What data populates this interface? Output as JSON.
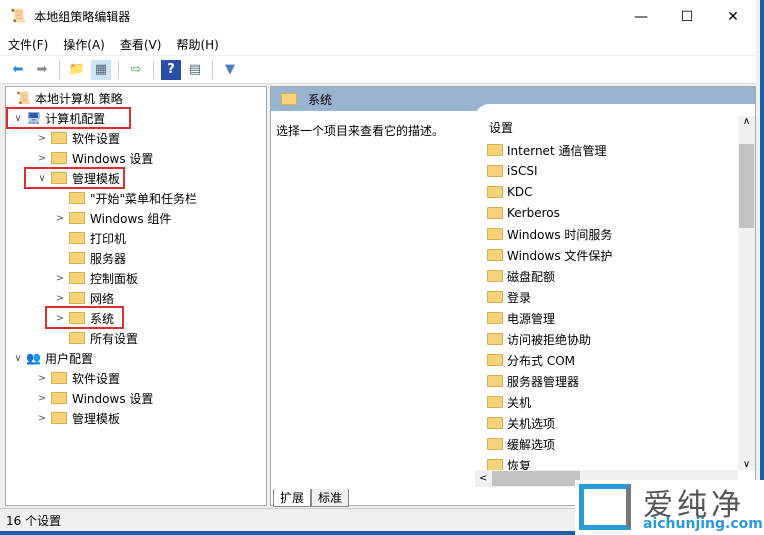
{
  "window": {
    "title": "本地组策略编辑器",
    "minimize": "—",
    "maximize": "☐",
    "close": "✕"
  },
  "menu": [
    "文件(F)",
    "操作(A)",
    "查看(V)",
    "帮助(H)"
  ],
  "tree": [
    {
      "label": "本地计算机 策略",
      "level": 0,
      "arrow": ""
    },
    {
      "label": "计算机配置",
      "level": 0,
      "arrow": "∨"
    },
    {
      "label": "软件设置",
      "level": 1,
      "arrow": ">"
    },
    {
      "label": "Windows 设置",
      "level": 1,
      "arrow": ">"
    },
    {
      "label": "管理模板",
      "level": 1,
      "arrow": "∨"
    },
    {
      "label": "\"开始\"菜单和任务栏",
      "level": 2,
      "arrow": ""
    },
    {
      "label": "Windows 组件",
      "level": 2,
      "arrow": ">"
    },
    {
      "label": "打印机",
      "level": 2,
      "arrow": ""
    },
    {
      "label": "服务器",
      "level": 2,
      "arrow": ""
    },
    {
      "label": "控制面板",
      "level": 2,
      "arrow": ">"
    },
    {
      "label": "网络",
      "level": 2,
      "arrow": ">"
    },
    {
      "label": "系统",
      "level": 2,
      "arrow": ">"
    },
    {
      "label": "所有设置",
      "level": 2,
      "arrow": ""
    },
    {
      "label": "用户配置",
      "level": 0,
      "arrow": "∨"
    },
    {
      "label": "软件设置",
      "level": 1,
      "arrow": ">"
    },
    {
      "label": "Windows 设置",
      "level": 1,
      "arrow": ">"
    },
    {
      "label": "管理模板",
      "level": 1,
      "arrow": ">"
    }
  ],
  "right": {
    "header": "系统",
    "description": "选择一个项目来查看它的描述。",
    "column": "设置",
    "items": [
      "Internet 通信管理",
      "iSCSI",
      "KDC",
      "Kerberos",
      "Windows 时间服务",
      "Windows 文件保护",
      "磁盘配额",
      "登录",
      "电源管理",
      "访问被拒绝协助",
      "分布式 COM",
      "服务器管理器",
      "关机",
      "关机选项",
      "缓解选项",
      "恢复"
    ]
  },
  "tabs": [
    "扩展",
    "标准"
  ],
  "status": "16 个设置",
  "watermark": {
    "brand": "爱纯净",
    "url": "aichunjing.com"
  }
}
